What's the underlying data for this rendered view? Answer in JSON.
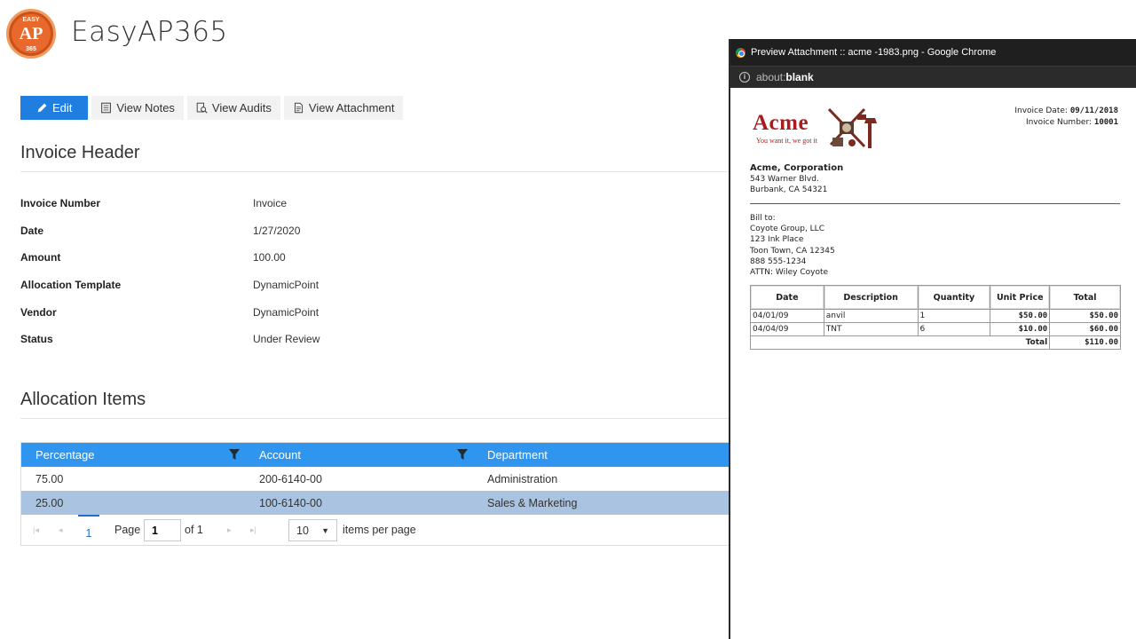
{
  "app": {
    "logo_top": "EASY",
    "logo_mid": "AP",
    "logo_bottom": "365",
    "title": "EasyAP365"
  },
  "toolbar": {
    "edit": "Edit",
    "view_notes": "View Notes",
    "view_audits": "View Audits",
    "view_attachment": "View Attachment"
  },
  "invoice_header": {
    "title": "Invoice Header",
    "fields": [
      {
        "label": "Invoice Number",
        "value": "Invoice"
      },
      {
        "label": "Date",
        "value": "1/27/2020"
      },
      {
        "label": "Amount",
        "value": "100.00"
      },
      {
        "label": "Allocation Template",
        "value": "DynamicPoint"
      },
      {
        "label": "Vendor",
        "value": "DynamicPoint"
      },
      {
        "label": "Status",
        "value": "Under Review"
      }
    ]
  },
  "allocation": {
    "title": "Allocation Items",
    "columns": [
      "Percentage",
      "Account",
      "Department"
    ],
    "rows": [
      {
        "percentage": "75.00",
        "account": "200-6140-00",
        "department": "Administration"
      },
      {
        "percentage": "25.00",
        "account": "100-6140-00",
        "department": "Sales & Marketing"
      }
    ],
    "pager": {
      "current": "1",
      "page_label": "Page",
      "page_value": "1",
      "of_label": "of 1",
      "per_page": "10",
      "per_page_label": "items per page"
    }
  },
  "popup": {
    "window_title": "Preview Attachment :: acme -1983.png - Google Chrome",
    "url_prefix": "about:",
    "url_bold": "blank",
    "document": {
      "logo_text": "Acme",
      "logo_tagline": "You want it, we got it",
      "invoice_date_label": "Invoice Date:",
      "invoice_date": "09/11/2018",
      "invoice_number_label": "Invoice Number:",
      "invoice_number": "10001",
      "company": {
        "name": "Acme, Corporation",
        "address1": "543 Warner Blvd.",
        "address2": "Burbank, CA 54321"
      },
      "bill_to": [
        "Bill to:",
        "Coyote Group, LLC",
        "123 Ink Place",
        "Toon Town, CA 12345",
        "888 555-1234",
        "ATTN: Wiley Coyote"
      ],
      "table": {
        "headers": [
          "Date",
          "Description",
          "Quantity",
          "Unit Price",
          "Total"
        ],
        "rows": [
          {
            "date": "04/01/09",
            "description": "anvil",
            "quantity": "1",
            "unit_price": "$50.00",
            "total": "$50.00"
          },
          {
            "date": "04/04/09",
            "description": "TNT",
            "quantity": "6",
            "unit_price": "$10.00",
            "total": "$60.00"
          }
        ],
        "total_label": "Total",
        "grand_total": "$110.00"
      }
    }
  }
}
